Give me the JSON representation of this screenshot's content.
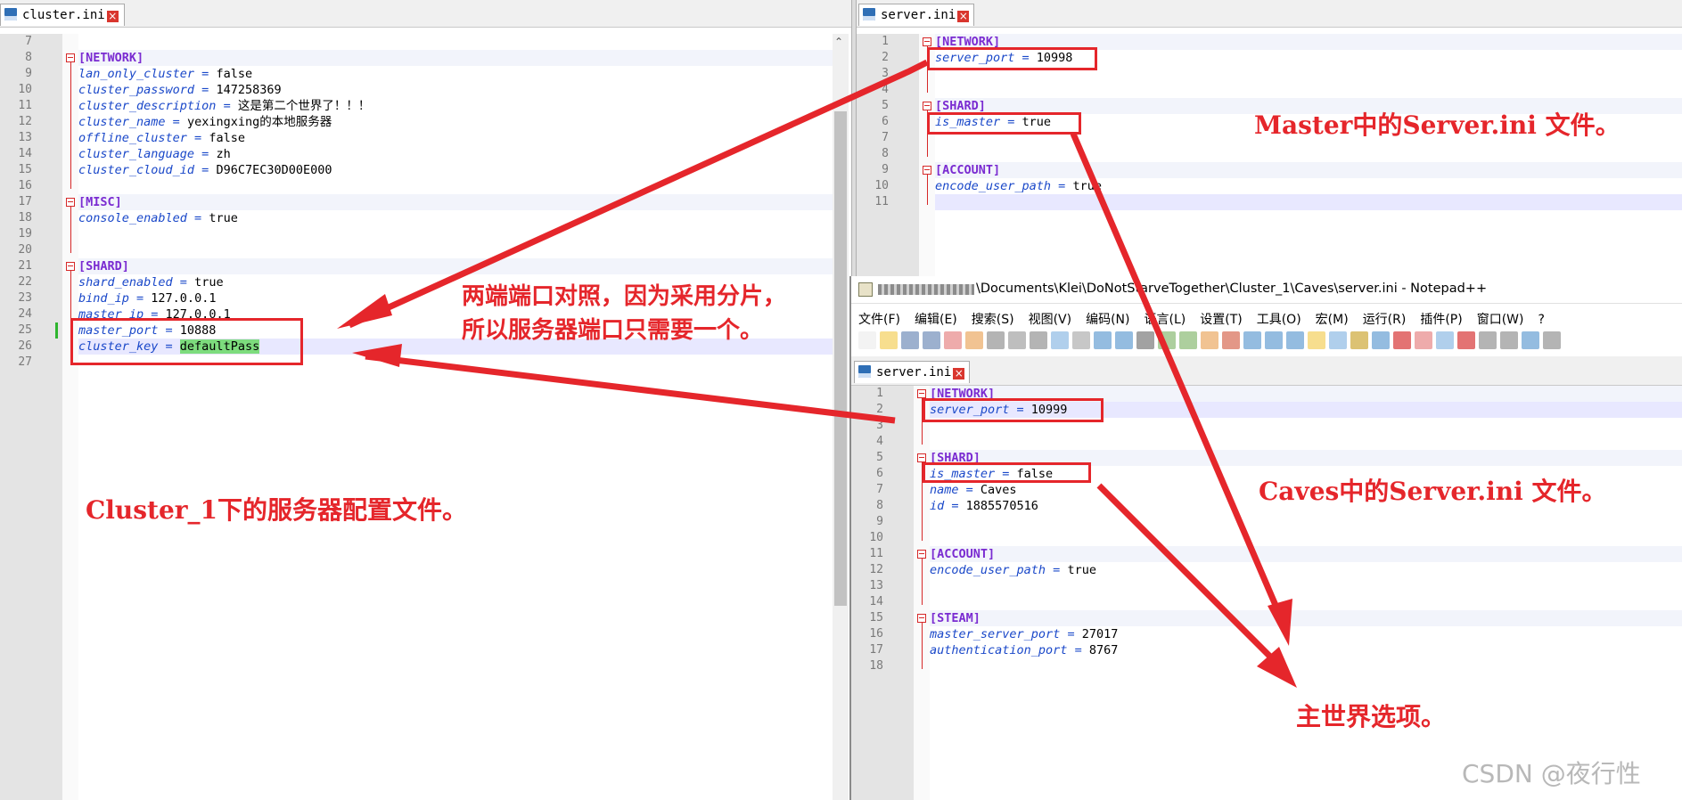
{
  "left_pane": {
    "tab_label": "cluster.ini",
    "lines": [
      {
        "n": "7",
        "t": "blank"
      },
      {
        "n": "8",
        "t": "section",
        "text": "[NETWORK]",
        "fold": true
      },
      {
        "n": "9",
        "t": "kv",
        "key": "lan_only_cluster",
        "value": "false"
      },
      {
        "n": "10",
        "t": "kv",
        "key": "cluster_password",
        "value": "147258369"
      },
      {
        "n": "11",
        "t": "kv",
        "key": "cluster_description",
        "value": "这是第二个世界了！！！"
      },
      {
        "n": "12",
        "t": "kv",
        "key": "cluster_name",
        "value": "yexingxing的本地服务器"
      },
      {
        "n": "13",
        "t": "kv",
        "key": "offline_cluster",
        "value": "false"
      },
      {
        "n": "14",
        "t": "kv",
        "key": "cluster_language",
        "value": "zh"
      },
      {
        "n": "15",
        "t": "kv",
        "key": "cluster_cloud_id",
        "value": "D96C7EC30D00E000"
      },
      {
        "n": "16",
        "t": "blank"
      },
      {
        "n": "17",
        "t": "section",
        "text": "[MISC]",
        "fold": true
      },
      {
        "n": "18",
        "t": "kv",
        "key": "console_enabled",
        "value": "true"
      },
      {
        "n": "19",
        "t": "blank"
      },
      {
        "n": "20",
        "t": "blank"
      },
      {
        "n": "21",
        "t": "section",
        "text": "[SHARD]",
        "fold": true
      },
      {
        "n": "22",
        "t": "kv",
        "key": "shard_enabled",
        "value": "true"
      },
      {
        "n": "23",
        "t": "kv",
        "key": "bind_ip",
        "value": "127.0.0.1"
      },
      {
        "n": "24",
        "t": "kv",
        "key": "master_ip",
        "value": "127.0.0.1"
      },
      {
        "n": "25",
        "t": "kv",
        "key": "master_port",
        "value": "10888"
      },
      {
        "n": "26",
        "t": "kv",
        "key": "cluster_key",
        "value": "defaultPass",
        "current": true,
        "selected": true
      },
      {
        "n": "27",
        "t": "blank"
      }
    ]
  },
  "master_pane": {
    "tab_label": "server.ini",
    "lines": [
      {
        "n": "1",
        "t": "section",
        "text": "[NETWORK]",
        "fold": true
      },
      {
        "n": "2",
        "t": "kv",
        "key": "server_port",
        "value": "10998"
      },
      {
        "n": "3",
        "t": "blank"
      },
      {
        "n": "4",
        "t": "blank"
      },
      {
        "n": "5",
        "t": "section",
        "text": "[SHARD]",
        "fold": true
      },
      {
        "n": "6",
        "t": "kv",
        "key": "is_master",
        "value": "true"
      },
      {
        "n": "7",
        "t": "blank"
      },
      {
        "n": "8",
        "t": "blank"
      },
      {
        "n": "9",
        "t": "section",
        "text": "[ACCOUNT]",
        "fold": true
      },
      {
        "n": "10",
        "t": "kv",
        "key": "encode_user_path",
        "value": "true"
      },
      {
        "n": "11",
        "t": "blank",
        "current": true
      }
    ]
  },
  "caves_window": {
    "title": "\\Documents\\Klei\\DoNotStarveTogether\\Cluster_1\\Caves\\server.ini - Notepad++",
    "menu": [
      "文件(F)",
      "编辑(E)",
      "搜索(S)",
      "视图(V)",
      "编码(N)",
      "语言(L)",
      "设置(T)",
      "工具(O)",
      "宏(M)",
      "运行(R)",
      "插件(P)",
      "窗口(W)",
      "?"
    ],
    "tab_label": "server.ini",
    "lines": [
      {
        "n": "1",
        "t": "section",
        "text": "[NETWORK]",
        "fold": true
      },
      {
        "n": "2",
        "t": "kv",
        "key": "server_port",
        "value": "10999",
        "current": true
      },
      {
        "n": "3",
        "t": "blank"
      },
      {
        "n": "4",
        "t": "blank"
      },
      {
        "n": "5",
        "t": "section",
        "text": "[SHARD]",
        "fold": true
      },
      {
        "n": "6",
        "t": "kv",
        "key": "is_master",
        "value": "false"
      },
      {
        "n": "7",
        "t": "kv",
        "key": "name",
        "value": "Caves"
      },
      {
        "n": "8",
        "t": "kv",
        "key": "id",
        "value": "1885570516"
      },
      {
        "n": "9",
        "t": "blank"
      },
      {
        "n": "10",
        "t": "blank"
      },
      {
        "n": "11",
        "t": "section",
        "text": "[ACCOUNT]",
        "fold": true
      },
      {
        "n": "12",
        "t": "kv",
        "key": "encode_user_path",
        "value": "true"
      },
      {
        "n": "13",
        "t": "blank"
      },
      {
        "n": "14",
        "t": "blank"
      },
      {
        "n": "15",
        "t": "section",
        "text": "[STEAM]",
        "fold": true
      },
      {
        "n": "16",
        "t": "kv",
        "key": "master_server_port",
        "value": "27017"
      },
      {
        "n": "17",
        "t": "kv",
        "key": "authentication_port",
        "value": "8767"
      },
      {
        "n": "18",
        "t": "blank"
      }
    ]
  },
  "annotations": {
    "ports_note_line1": "两端端口对照，因为采用分片，",
    "ports_note_line2": "所以服务器端口只需要一个。",
    "cluster_note": "Cluster_1下的服务器配置文件。",
    "master_note": "Master中的Server.ini 文件。",
    "caves_note": "Caves中的Server.ini 文件。",
    "main_world_note": "主世界选项。"
  },
  "watermark": "CSDN @夜行性",
  "colors": {
    "annotation_red": "#e5262b",
    "section_purple": "#7a2bd1",
    "key_blue": "#1a48c9",
    "selection_green": "#7ddc7d"
  }
}
